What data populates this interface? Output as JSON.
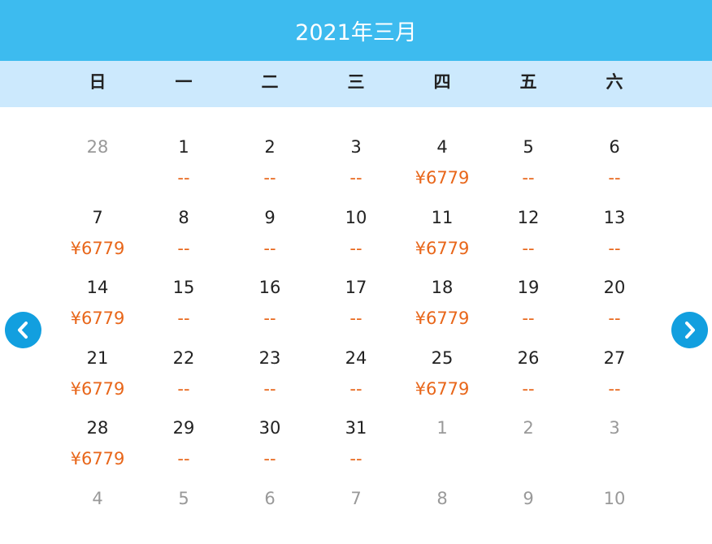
{
  "title": "2021年三月",
  "weekdays": [
    "日",
    "一",
    "二",
    "三",
    "四",
    "五",
    "六"
  ],
  "colors": {
    "header": "#3dbbef",
    "weekday_bar": "#cce9fd",
    "price": "#e8661a",
    "nav": "#129fdf"
  },
  "nav": {
    "prev_icon": "chevron-left-icon",
    "next_icon": "chevron-right-icon"
  },
  "days": [
    {
      "day": "28",
      "price": "",
      "muted": true
    },
    {
      "day": "1",
      "price": "--"
    },
    {
      "day": "2",
      "price": "--"
    },
    {
      "day": "3",
      "price": "--"
    },
    {
      "day": "4",
      "price": "¥6779"
    },
    {
      "day": "5",
      "price": "--"
    },
    {
      "day": "6",
      "price": "--"
    },
    {
      "day": "7",
      "price": "¥6779"
    },
    {
      "day": "8",
      "price": "--"
    },
    {
      "day": "9",
      "price": "--"
    },
    {
      "day": "10",
      "price": "--"
    },
    {
      "day": "11",
      "price": "¥6779"
    },
    {
      "day": "12",
      "price": "--"
    },
    {
      "day": "13",
      "price": "--"
    },
    {
      "day": "14",
      "price": "¥6779"
    },
    {
      "day": "15",
      "price": "--"
    },
    {
      "day": "16",
      "price": "--"
    },
    {
      "day": "17",
      "price": "--"
    },
    {
      "day": "18",
      "price": "¥6779"
    },
    {
      "day": "19",
      "price": "--"
    },
    {
      "day": "20",
      "price": "--"
    },
    {
      "day": "21",
      "price": "¥6779"
    },
    {
      "day": "22",
      "price": "--"
    },
    {
      "day": "23",
      "price": "--"
    },
    {
      "day": "24",
      "price": "--"
    },
    {
      "day": "25",
      "price": "¥6779"
    },
    {
      "day": "26",
      "price": "--"
    },
    {
      "day": "27",
      "price": "--"
    },
    {
      "day": "28",
      "price": "¥6779"
    },
    {
      "day": "29",
      "price": "--"
    },
    {
      "day": "30",
      "price": "--"
    },
    {
      "day": "31",
      "price": "--"
    },
    {
      "day": "1",
      "price": "",
      "muted": true
    },
    {
      "day": "2",
      "price": "",
      "muted": true
    },
    {
      "day": "3",
      "price": "",
      "muted": true
    },
    {
      "day": "4",
      "price": "",
      "muted": true
    },
    {
      "day": "5",
      "price": "",
      "muted": true
    },
    {
      "day": "6",
      "price": "",
      "muted": true
    },
    {
      "day": "7",
      "price": "",
      "muted": true
    },
    {
      "day": "8",
      "price": "",
      "muted": true
    },
    {
      "day": "9",
      "price": "",
      "muted": true
    },
    {
      "day": "10",
      "price": "",
      "muted": true
    }
  ]
}
